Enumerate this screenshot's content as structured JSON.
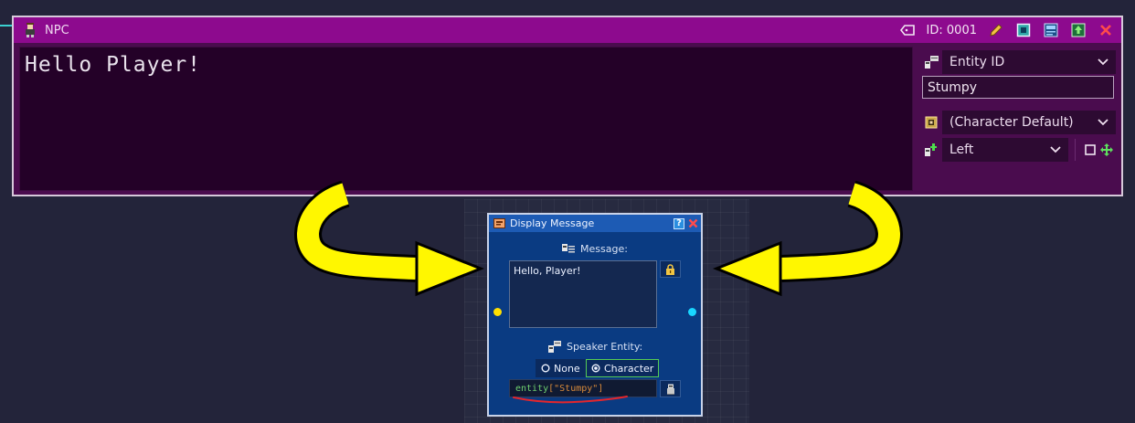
{
  "npc_window": {
    "title": "NPC",
    "id_label": "ID: 0001",
    "message_text": "Hello Player!",
    "speaker_mode": "Entity ID",
    "speaker_value": "Stumpy",
    "portrait": "(Character Default)",
    "position": "Left",
    "colors": {
      "title_bar": "#8d0a8e",
      "body": "#4a0c4e",
      "text_area": "#240128"
    },
    "icons": [
      "npc-character-icon",
      "tag-icon",
      "pencil-icon",
      "image-icon",
      "layout-icon",
      "export-icon",
      "close-icon",
      "speaker-icon",
      "portrait-icon",
      "position-icon",
      "checkbox-icon",
      "move-icon"
    ]
  },
  "display_node": {
    "title": "Display Message",
    "message_label": "Message:",
    "message_value": "Hello, Player!",
    "speaker_label": "Speaker Entity:",
    "radio_none": "None",
    "radio_character": "Character",
    "code_prefix": "entity",
    "code_args": "[\"Stumpy\"]",
    "colors": {
      "title_bar": "#1d5bb4",
      "body": "#0a3b82",
      "input_dot": "#ffe000",
      "output_dot": "#19d6ff",
      "code_keyword": "#6fd16f",
      "code_string": "#d88a3a"
    }
  },
  "annotations": {
    "arrow_color": "#fff700",
    "underline_color": "#e4262c"
  }
}
